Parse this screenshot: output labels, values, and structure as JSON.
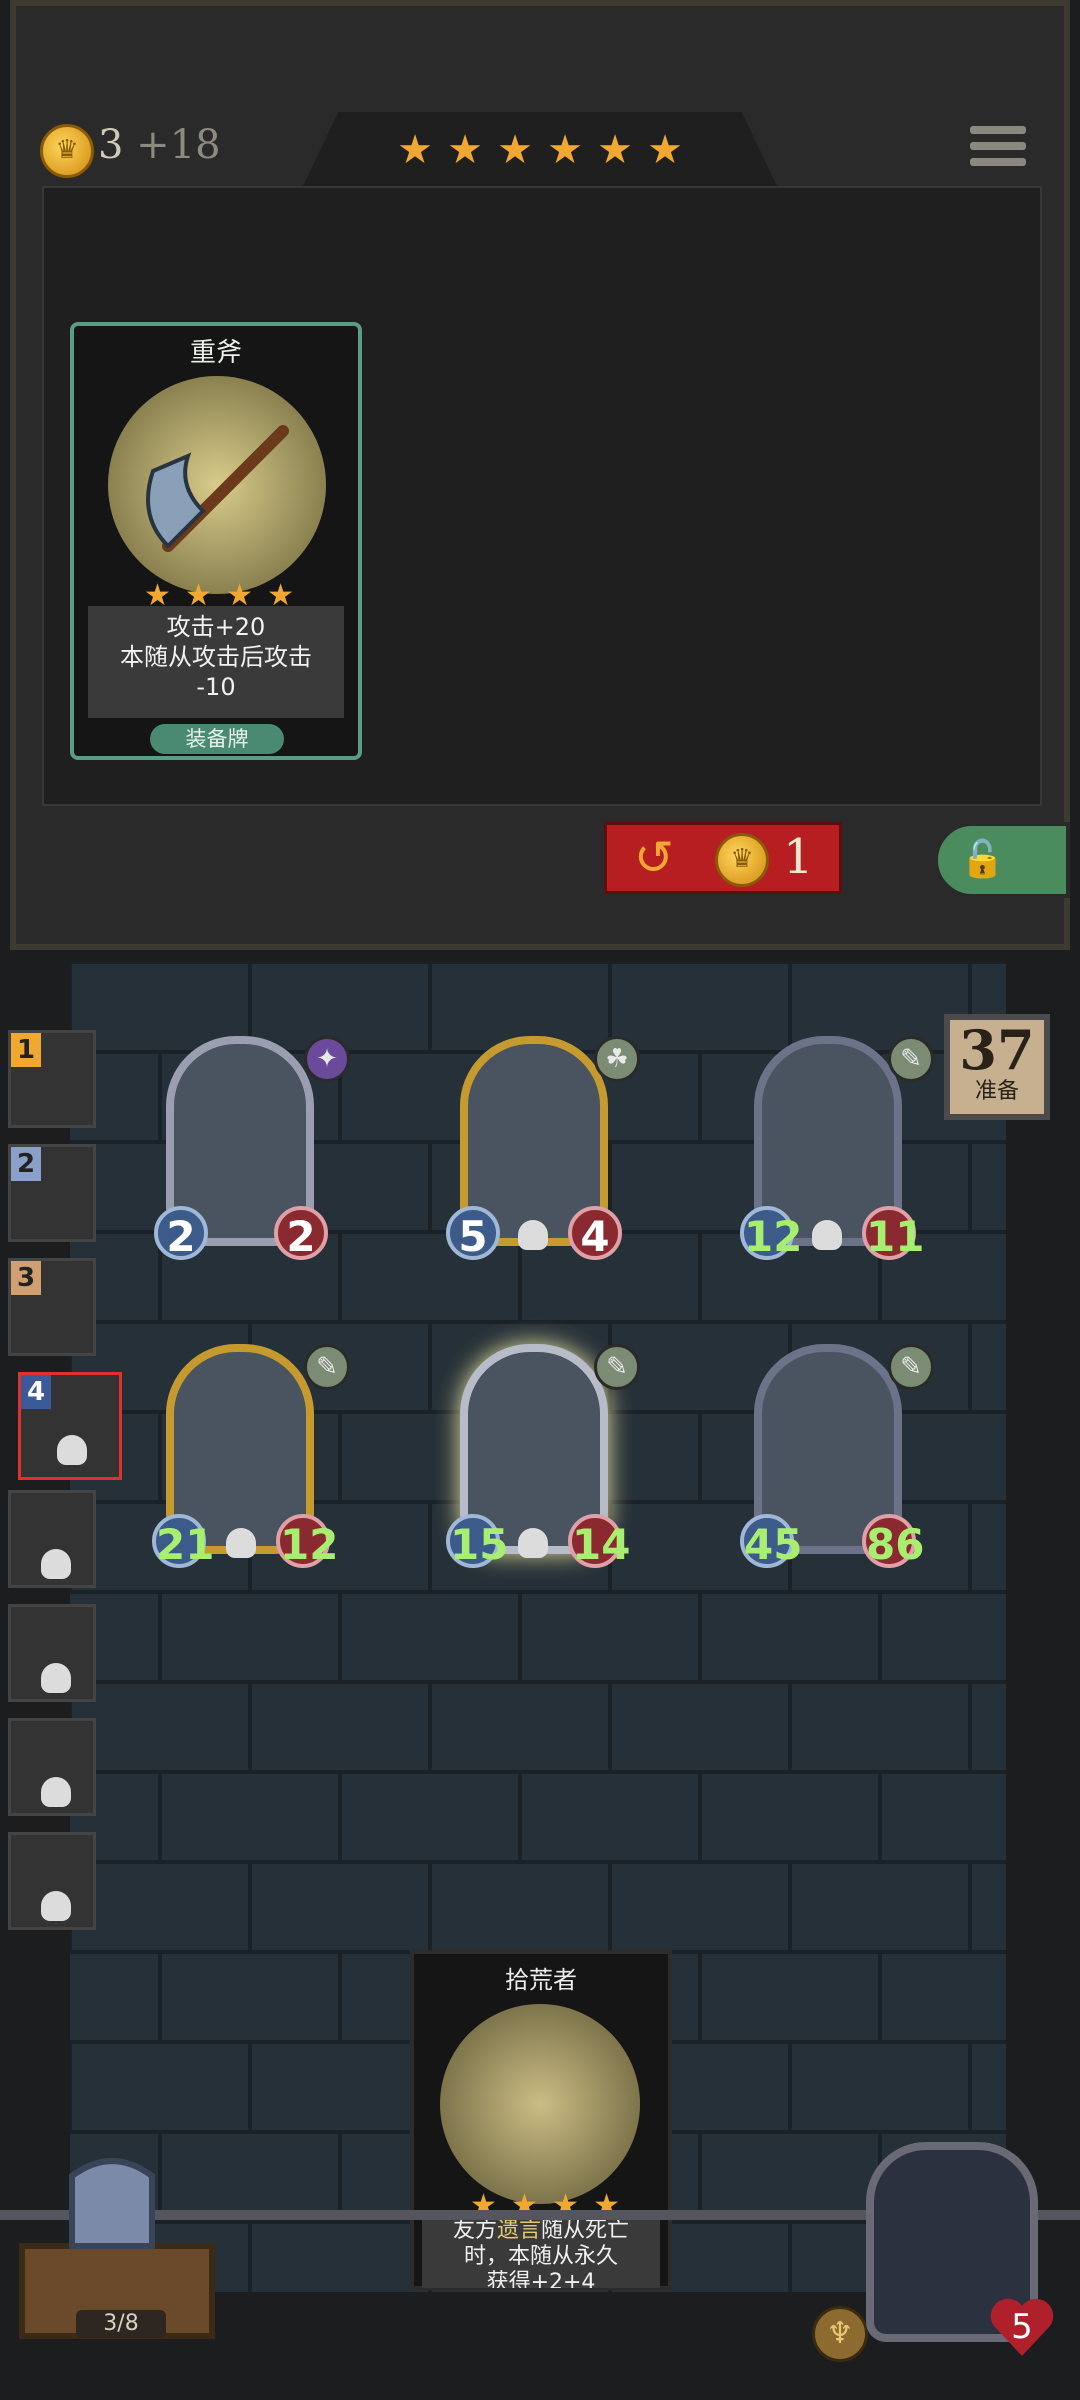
{
  "header": {
    "gold": "3",
    "gold_bonus": "+18",
    "tavern_stars": [
      "★",
      "★",
      "★",
      "★",
      "★",
      "★"
    ],
    "menu_icon": "menu-icon"
  },
  "shop": {
    "offer": {
      "title": "重斧",
      "stars": [
        "★",
        "★",
        "★",
        "★"
      ],
      "desc_line1": "攻击+20",
      "desc_line2": "本随从攻击后攻击",
      "desc_line3": "-10",
      "type": "装备牌",
      "icon": "axe-icon"
    },
    "refresh_cost": "1",
    "refresh_icon": "refresh-arrow-icon",
    "lock_icon": "unlock-icon"
  },
  "timer": {
    "value": "37",
    "label": "准备"
  },
  "sidebar": {
    "players": [
      {
        "rank": "1"
      },
      {
        "rank": "2"
      },
      {
        "rank": "3"
      },
      {
        "rank": "4"
      },
      {
        "rank": ""
      },
      {
        "rank": ""
      },
      {
        "rank": ""
      },
      {
        "rank": ""
      }
    ]
  },
  "board": {
    "minions": [
      {
        "attack": "2",
        "health": "2"
      },
      {
        "attack": "5",
        "health": "4"
      },
      {
        "attack": "12",
        "health": "11"
      },
      {
        "attack": "21",
        "health": "12"
      },
      {
        "attack": "15",
        "health": "14"
      },
      {
        "attack": "45",
        "health": "86"
      }
    ]
  },
  "hand": {
    "card": {
      "title": "拾荒者",
      "stars": [
        "★",
        "★",
        "★",
        "★"
      ],
      "desc_a": "友方",
      "desc_hl": "遗言",
      "desc_b": "随从死亡",
      "desc_line2": "时，本随从永久",
      "desc_line3": "获得+2+4"
    }
  },
  "bottom": {
    "chest_count": "3/8",
    "hero_health": "5"
  },
  "colors": {
    "accent_gold": "#f0a830",
    "refresh_red": "#b61e22",
    "lock_green": "#4b8c5e",
    "equip_teal": "#5c9c84",
    "stat_green": "#a8ee70"
  }
}
